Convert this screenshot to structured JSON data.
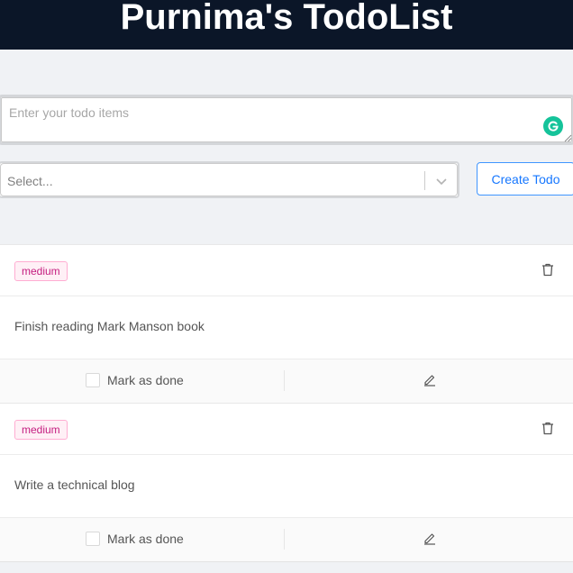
{
  "header": {
    "title": "Purnima's TodoList"
  },
  "form": {
    "todo_placeholder": "Enter your todo items",
    "todo_value": "",
    "select_placeholder": "Select...",
    "create_label": "Create Todo"
  },
  "todos": [
    {
      "priority": "medium",
      "text": "Finish reading Mark Manson book",
      "mark_label": "Mark as done",
      "done": false
    },
    {
      "priority": "medium",
      "text": "Write a technical blog",
      "mark_label": "Mark as done",
      "done": false
    }
  ],
  "colors": {
    "header_bg": "#0b1628",
    "page_bg": "#f0f2f5",
    "accent": "#1677ff",
    "tag_text": "#c41d7f",
    "tag_border": "#ffadd2",
    "tag_bg": "#fff0f6",
    "grammarly": "#15c39a"
  },
  "icons": {
    "grammarly": "grammarly-icon",
    "chevron": "chevron-down-icon",
    "delete": "trash-icon",
    "edit": "edit-pencil-icon"
  }
}
